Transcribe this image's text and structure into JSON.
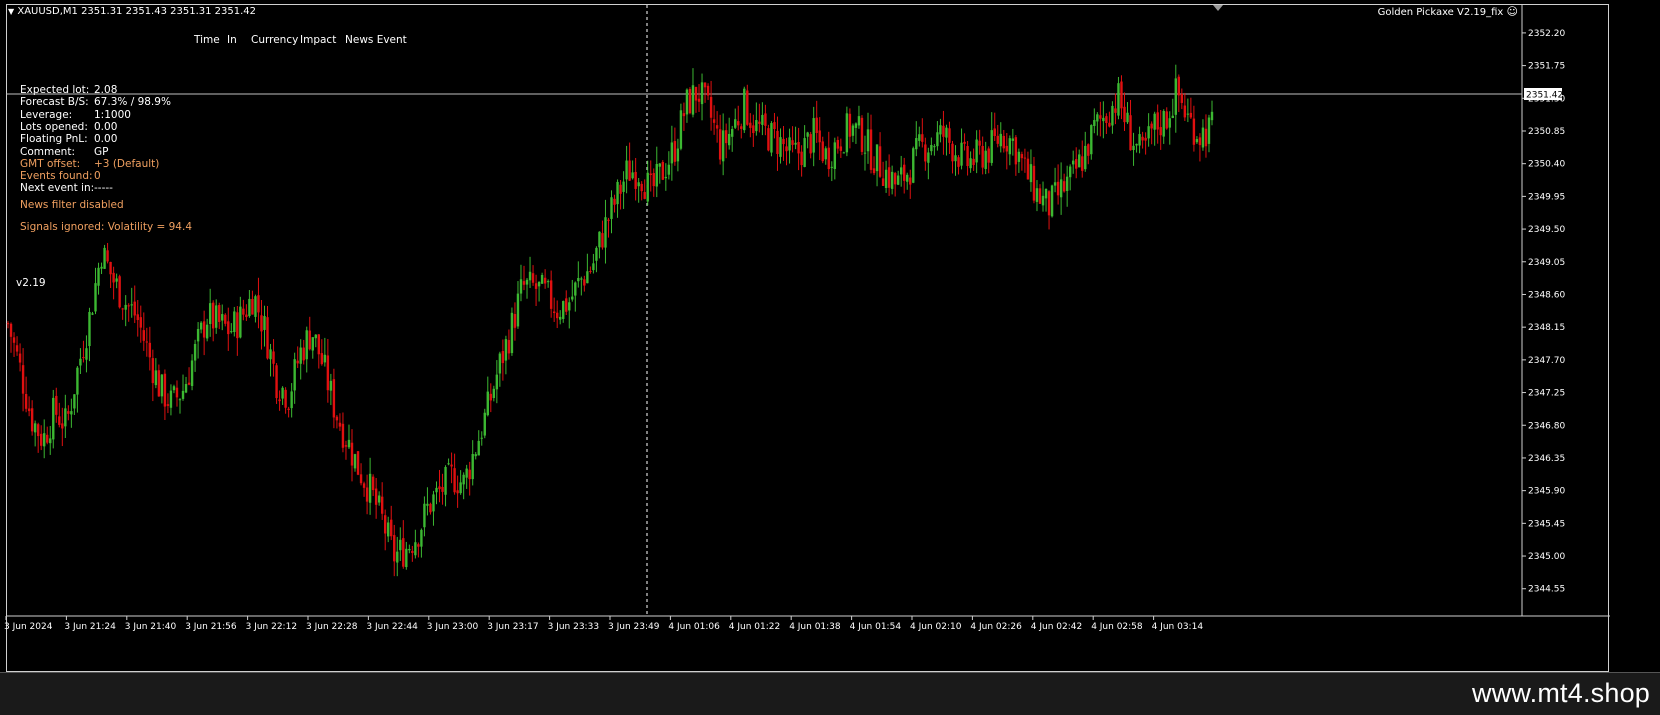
{
  "header": {
    "symbol_line": "XAUUSD,M1  2351.31 2351.43 2351.31 2351.42",
    "indicator_title": "Golden Pickaxe V2.19_fix",
    "news_columns": [
      "Time",
      "In",
      "Currency",
      "Impact",
      "News Event"
    ]
  },
  "info_panel": {
    "rows": [
      {
        "label": "Expected lot:",
        "value": "2.08",
        "color": "#ffffff"
      },
      {
        "label": "Forecast B/S:",
        "value": "67.3% / 98.9%",
        "color": "#ffffff"
      },
      {
        "label": "Leverage:",
        "value": "1:1000",
        "color": "#ffffff"
      },
      {
        "label": "Lots opened:",
        "value": "0.00",
        "color": "#ffffff"
      },
      {
        "label": "Floating PnL:",
        "value": "0.00",
        "color": "#ffffff"
      },
      {
        "label": "Comment:",
        "value": "GP",
        "color": "#ffffff"
      },
      {
        "label": "GMT offset:",
        "value": "+3 (Default)",
        "color": "#f0a060"
      },
      {
        "label": "Events found:",
        "value": "0",
        "color": "#f0a060"
      },
      {
        "label": "Next event in:",
        "value": "-----",
        "color": "#ffffff"
      }
    ],
    "news_filter_status": "News filter disabled",
    "signals_status": "Signals ignored: Volatility = 94.4",
    "version_label": "v2.19"
  },
  "price_axis": {
    "current_price": "2351.42",
    "ticks": [
      "2352.20",
      "2351.75",
      "2351.30",
      "2350.85",
      "2350.40",
      "2349.95",
      "2349.50",
      "2349.05",
      "2348.60",
      "2348.15",
      "2347.70",
      "2347.25",
      "2346.80",
      "2346.35",
      "2345.90",
      "2345.45",
      "2345.00",
      "2344.55"
    ]
  },
  "time_axis": {
    "ticks": [
      "3 Jun 2024",
      "3 Jun 21:24",
      "3 Jun 21:40",
      "3 Jun 21:56",
      "3 Jun 22:12",
      "3 Jun 22:28",
      "3 Jun 22:44",
      "3 Jun 23:00",
      "3 Jun 23:17",
      "3 Jun 23:33",
      "3 Jun 23:49",
      "4 Jun 01:06",
      "4 Jun 01:22",
      "4 Jun 01:38",
      "4 Jun 01:54",
      "4 Jun 02:10",
      "4 Jun 02:26",
      "4 Jun 02:42",
      "4 Jun 02:58",
      "4 Jun 03:14"
    ]
  },
  "colors": {
    "bull": "#3cb832",
    "bear": "#e01010",
    "grid_line": "#c0c0c0",
    "accent_orange": "#f0a060"
  },
  "chart_data": {
    "type": "candlestick",
    "symbol": "XAUUSD",
    "timeframe": "M1",
    "ylim": [
      2344.45,
      2352.35
    ],
    "close_path": [
      2348.2,
      2347.6,
      2346.9,
      2346.6,
      2347.0,
      2346.8,
      2347.6,
      2348.3,
      2349.2,
      2348.8,
      2348.5,
      2348.3,
      2347.8,
      2347.3,
      2347.1,
      2347.3,
      2347.8,
      2348.3,
      2348.2,
      2348.1,
      2348.3,
      2348.6,
      2348.1,
      2347.4,
      2347.2,
      2347.8,
      2348.1,
      2347.6,
      2347.0,
      2346.6,
      2346.2,
      2345.9,
      2345.5,
      2345.0,
      2345.1,
      2345.3,
      2345.7,
      2345.9,
      2346.1,
      2346.0,
      2346.5,
      2347.0,
      2347.6,
      2348.1,
      2348.7,
      2348.7,
      2348.6,
      2348.4,
      2348.5,
      2348.8,
      2349.0,
      2349.5,
      2349.9,
      2350.3,
      2350.3,
      2350.0,
      2350.3,
      2350.6,
      2351.2,
      2351.4,
      2351.1,
      2350.6,
      2350.9,
      2351.2,
      2350.9,
      2350.8,
      2350.7,
      2350.5,
      2350.6,
      2350.8,
      2350.5,
      2350.7,
      2350.9,
      2350.8,
      2350.5,
      2350.3,
      2350.1,
      2350.3,
      2350.6,
      2350.7,
      2350.8,
      2350.6,
      2350.4,
      2350.5,
      2350.6,
      2350.8,
      2350.7,
      2350.3,
      2350.0,
      2349.8,
      2350.0,
      2350.2,
      2350.5,
      2350.9,
      2351.1,
      2351.3,
      2350.8,
      2350.5,
      2350.9,
      2351.0,
      2351.4,
      2351.0,
      2350.8,
      2350.9
    ]
  }
}
